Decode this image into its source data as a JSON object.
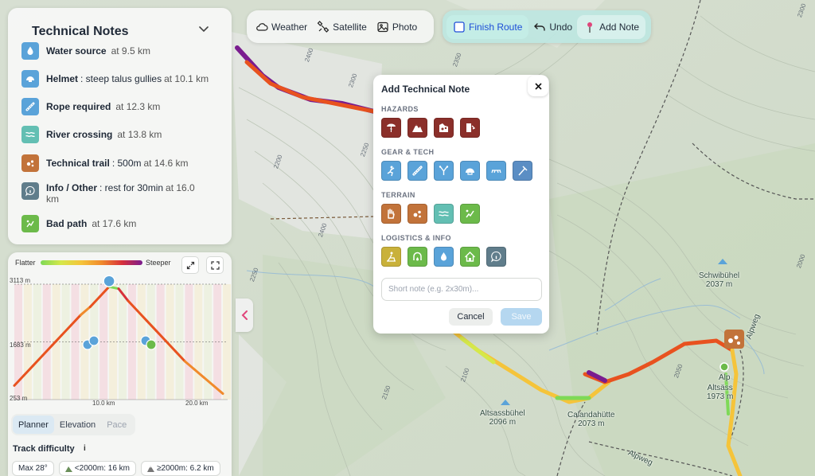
{
  "toolbar": {
    "weather": "Weather",
    "satellite": "Satellite",
    "photo": "Photo",
    "finish_route": "Finish Route",
    "undo": "Undo",
    "add_note": "Add Note"
  },
  "notes_panel": {
    "title": "Technical Notes",
    "items": [
      {
        "icon": "water-drop-icon",
        "color": "#5aa3d9",
        "bold": "Water source",
        "rest": "",
        "location": "at 9.5 km"
      },
      {
        "icon": "helmet-icon",
        "color": "#5aa3d9",
        "bold": "Helmet",
        "rest": ": steep talus gullies",
        "location": "at 10.1 km"
      },
      {
        "icon": "rope-icon",
        "color": "#5aa3d9",
        "bold": "Rope required",
        "rest": "",
        "location": "at 12.3 km"
      },
      {
        "icon": "river-icon",
        "color": "#63bfb3",
        "bold": "River crossing",
        "rest": "",
        "location": "at 13.8 km"
      },
      {
        "icon": "rocks-icon",
        "color": "#c2733a",
        "bold": "Technical trail",
        "rest": ": 500m",
        "location": "at 14.6 km"
      },
      {
        "icon": "info-icon",
        "color": "#607d8b",
        "bold": "Info / Other",
        "rest": ": rest for 30min",
        "location": "at 16.0 km"
      },
      {
        "icon": "bad-path-icon",
        "color": "#6cba4a",
        "bold": "Bad path",
        "rest": "",
        "location": "at 17.6 km"
      }
    ]
  },
  "elevation": {
    "legend_flatter": "Flatter",
    "legend_steeper": "Steeper",
    "y_top": "3113 m",
    "y_mid": "1683 m",
    "y_bottom": "253 m",
    "x_mid": "10.0 km",
    "x_right": "20.0 km",
    "tabs": [
      "Planner",
      "Elevation",
      "Pace"
    ],
    "track_difficulty_label": "Track difficulty",
    "info_symbol": "i",
    "chips": [
      "Max 28°",
      "<2000m: 16 km",
      "≥2000m: 6.2 km"
    ]
  },
  "chart_data": {
    "type": "area",
    "x": [
      0,
      1,
      2,
      3,
      4,
      5,
      6,
      7,
      8,
      9,
      10,
      11,
      12,
      13,
      14,
      15,
      16,
      17,
      18,
      19,
      20,
      21,
      22
    ],
    "y": [
      600,
      850,
      1100,
      1350,
      1600,
      1850,
      2100,
      2350,
      2550,
      2800,
      3050,
      3000,
      2700,
      2450,
      2200,
      1950,
      1700,
      1450,
      1200,
      1000,
      800,
      600,
      400
    ],
    "xlabel": "",
    "ylabel": "",
    "ylim": [
      253,
      3113
    ],
    "xlim": [
      0,
      22.5
    ],
    "grid": true
  },
  "modal": {
    "title": "Add Technical Note",
    "close_symbol": "✕",
    "sections": [
      {
        "label": "HAZARDS",
        "tiles": [
          {
            "icon": "lightning-icon",
            "color": "#8b2f2a"
          },
          {
            "icon": "avalanche-icon",
            "color": "#8b2f2a"
          },
          {
            "icon": "rockfall-icon",
            "color": "#8b2f2a"
          },
          {
            "icon": "exposure-icon",
            "color": "#8b2f2a"
          }
        ]
      },
      {
        "label": "GEAR & TECH",
        "tiles": [
          {
            "icon": "climbing-icon",
            "color": "#5aa3d9"
          },
          {
            "icon": "rope-icon",
            "color": "#5aa3d9"
          },
          {
            "icon": "via-ferrata-icon",
            "color": "#5aa3d9"
          },
          {
            "icon": "helmet-icon",
            "color": "#5aa3d9"
          },
          {
            "icon": "crampons-icon",
            "color": "#5aa3d9"
          },
          {
            "icon": "ice-axe-icon",
            "color": "#5b8ec4"
          }
        ]
      },
      {
        "label": "TERRAIN",
        "tiles": [
          {
            "icon": "scramble-hand-icon",
            "color": "#c2733a"
          },
          {
            "icon": "rocks-icon",
            "color": "#c2733a"
          },
          {
            "icon": "river-icon",
            "color": "#63bfb3"
          },
          {
            "icon": "bad-path-icon",
            "color": "#6cba4a"
          }
        ]
      },
      {
        "label": "LOGISTICS & INFO",
        "tiles": [
          {
            "icon": "rest-icon",
            "color": "#c9b13a"
          },
          {
            "icon": "spring-icon",
            "color": "#6cba4a"
          },
          {
            "icon": "water-drop-icon",
            "color": "#5aa3d9"
          },
          {
            "icon": "hut-icon",
            "color": "#6cba4a"
          },
          {
            "icon": "info-icon",
            "color": "#607d8b"
          }
        ]
      }
    ],
    "placeholder": "Short note (e.g. 2x30m)...",
    "cancel": "Cancel",
    "save": "Save"
  },
  "map_labels": {
    "schwibuhel": "Schwibühel",
    "schwibuhel_elev": "2037 m",
    "altsassbuhel": "Altsassbühel",
    "altsassbuhel_elev": "2096 m",
    "calandahutte": "Calandahütte",
    "calandahutte_elev": "2073 m",
    "alp1": "Alp",
    "altsass": "Altsäss",
    "altsass_elev": "1973 m",
    "alpweg_top": "Alpweg",
    "alpweg_bottom": "Alpweg",
    "contours": [
      "2400",
      "2350",
      "2300",
      "2250",
      "2200",
      "2150",
      "2100",
      "2050",
      "2000",
      "2250",
      "2400",
      "2300",
      "2150"
    ]
  },
  "colors": {
    "accent_blue": "#1d4ed8",
    "teal_toolbar": "#bde6e1",
    "hazard": "#8b2f2a",
    "gear": "#5aa3d9"
  }
}
